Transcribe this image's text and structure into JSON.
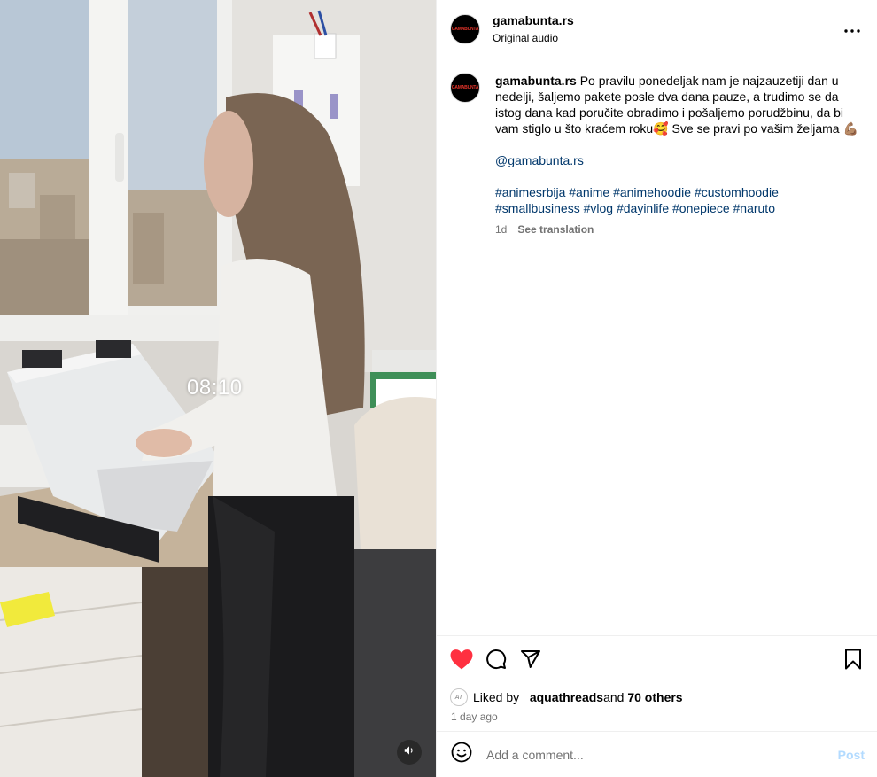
{
  "media": {
    "time_overlay": "08:10",
    "mute_icon": "speaker-icon"
  },
  "header": {
    "username": "gamabunta.rs",
    "audio": "Original audio",
    "avatar_logo": "GAMABUNTA",
    "more_icon": "more-horizontal-icon"
  },
  "caption": {
    "username": "gamabunta.rs",
    "text": " Po pravilu ponedeljak nam je najzauzetiji dan u nedelji, šaljemo pakete posle dva dana pauze, a trudimo se da istog dana kad poručite obradimo i pošaljemo porudžbinu, da bi vam stiglo u što kraćem roku🥰 Sve se pravi po vašim željama 💪🏽",
    "mention": "@gamabunta.rs",
    "hashtags": "#animesrbija #anime #animehoodie #customhoodie #smallbusiness #vlog #dayinlife #onepiece #naruto",
    "age": "1d",
    "translate": "See translation"
  },
  "actions": {
    "like_icon": "heart-filled-icon",
    "comment_icon": "comment-icon",
    "share_icon": "share-icon",
    "save_icon": "bookmark-icon",
    "like_color": "#ff3040"
  },
  "likes": {
    "avatar_initials": "AT",
    "prefix": "Liked by ",
    "user": "_aquathreads",
    "middle": " and ",
    "others": "70 others"
  },
  "posted": "1 day ago",
  "comment_box": {
    "emoji_icon": "smiley-icon",
    "placeholder": "Add a comment...",
    "post_label": "Post"
  }
}
